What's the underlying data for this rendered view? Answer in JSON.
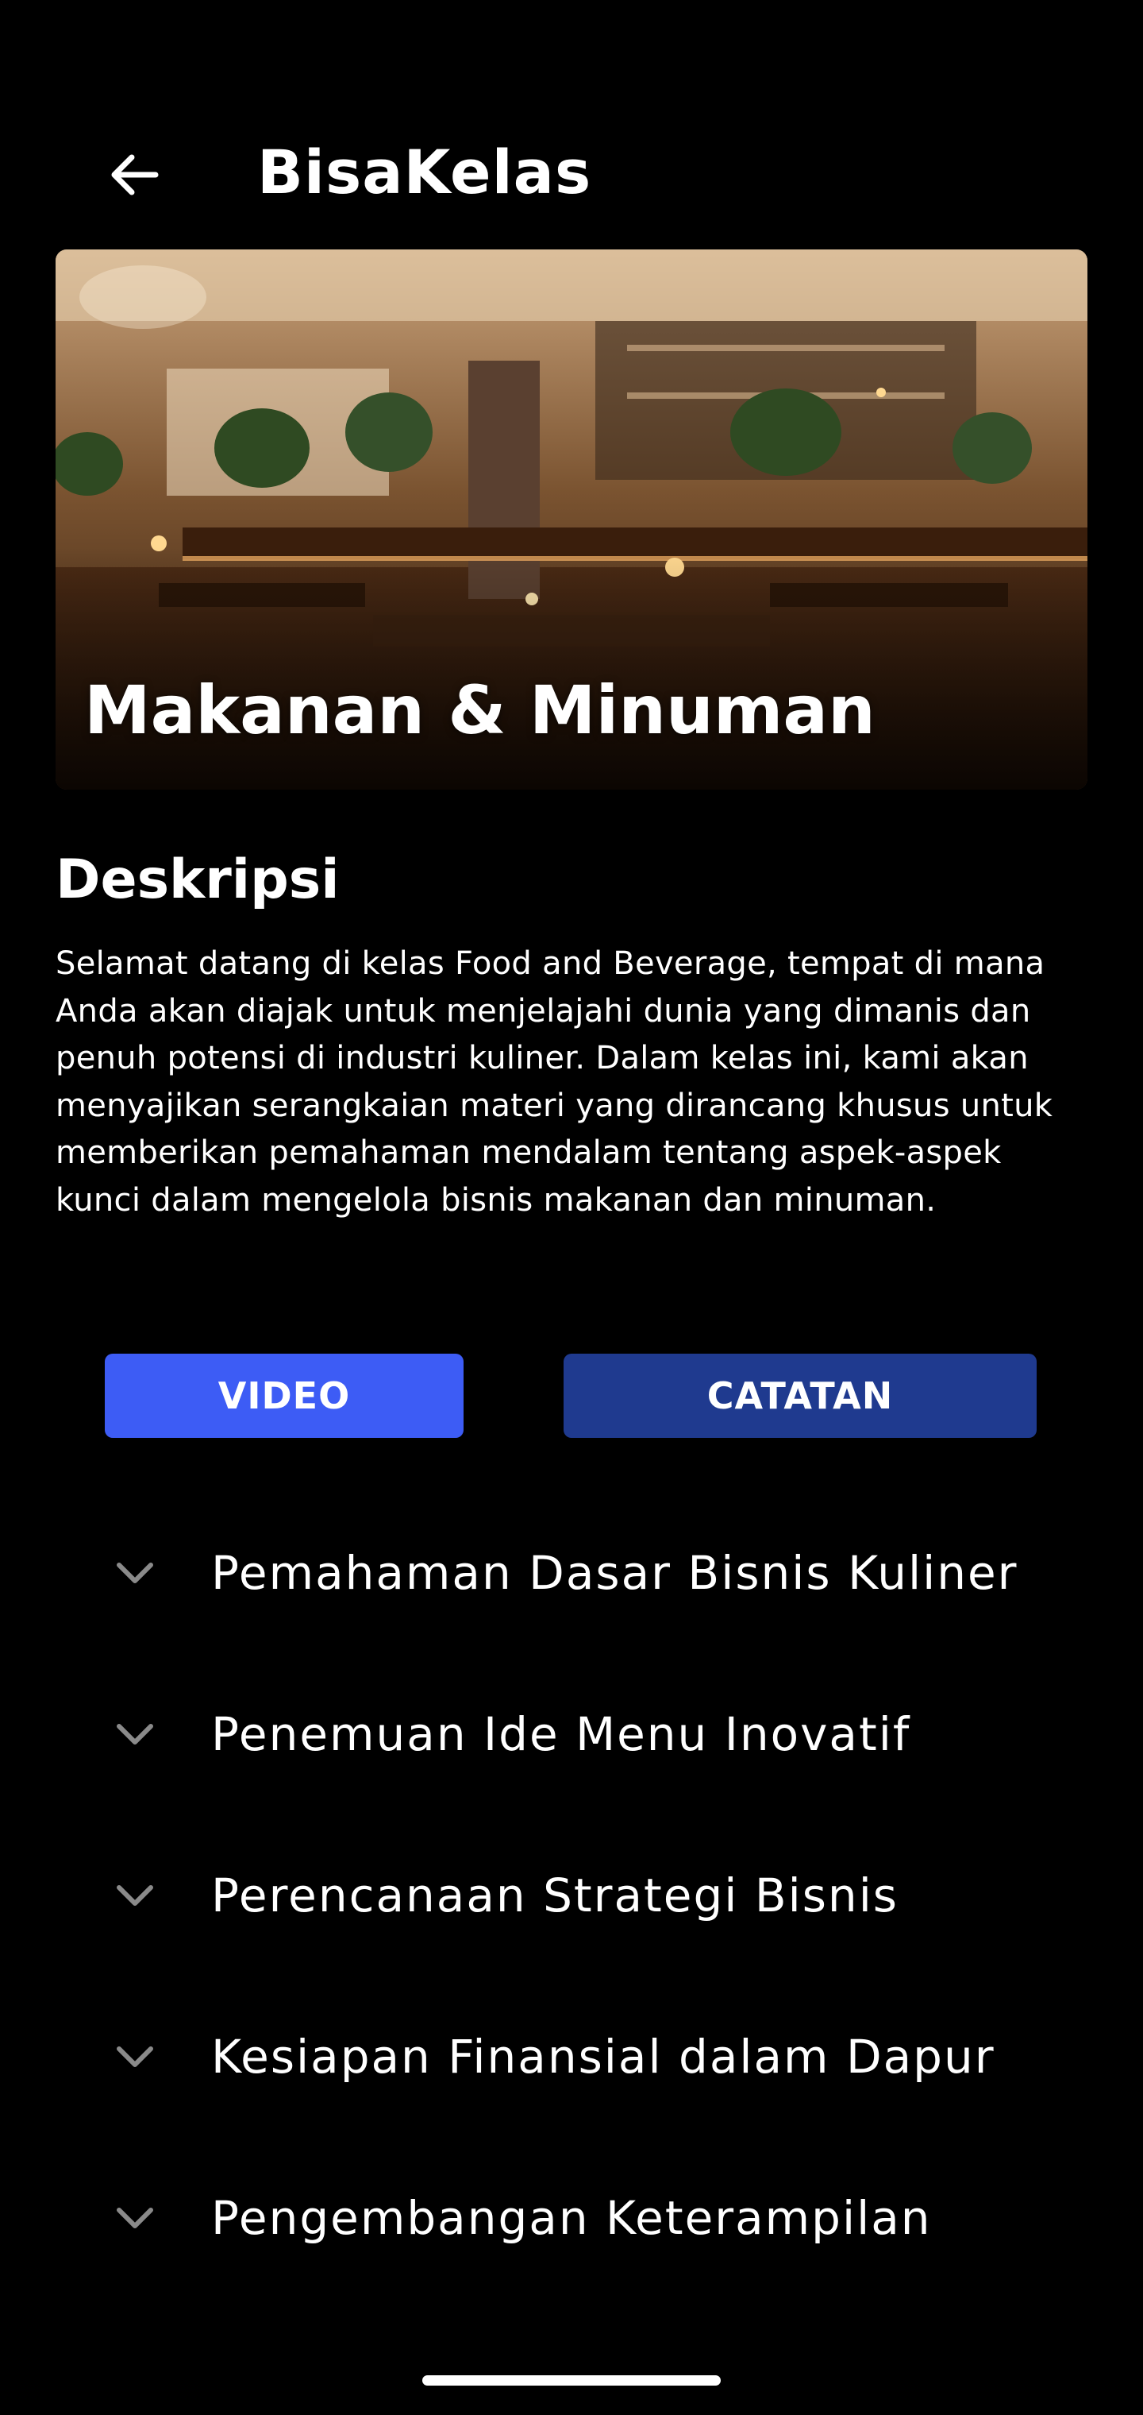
{
  "header": {
    "app_title": "BisaKelas",
    "back_icon": "arrow-left-icon"
  },
  "hero": {
    "title": "Makanan & Minuman",
    "image": "restaurant-interior-photo"
  },
  "description": {
    "heading": "Deskripsi",
    "text": "Selamat datang di kelas Food and Beverage, tempat di mana Anda akan diajak untuk menjelajahi dunia yang dimanis dan penuh potensi di industri kuliner. Dalam kelas ini, kami akan menyajikan serangkaian materi yang dirancang khusus untuk memberikan pemahaman mendalam tentang aspek-aspek kunci dalam mengelola bisnis makanan dan minuman."
  },
  "tabs": {
    "video_label": "VIDEO",
    "notes_label": "CATATAN",
    "video_color": "#3d5cf5",
    "notes_color": "#1f3a8f"
  },
  "modules": [
    {
      "label": "Pemahaman Dasar Bisnis Kuliner",
      "icon": "chevron-down-icon"
    },
    {
      "label": "Penemuan Ide Menu Inovatif",
      "icon": "chevron-down-icon"
    },
    {
      "label": "Perencanaan Strategi Bisnis",
      "icon": "chevron-down-icon"
    },
    {
      "label": "Kesiapan Finansial dalam Dapur",
      "icon": "chevron-down-icon"
    },
    {
      "label": "Pengembangan Keterampilan",
      "icon": "chevron-down-icon"
    }
  ]
}
